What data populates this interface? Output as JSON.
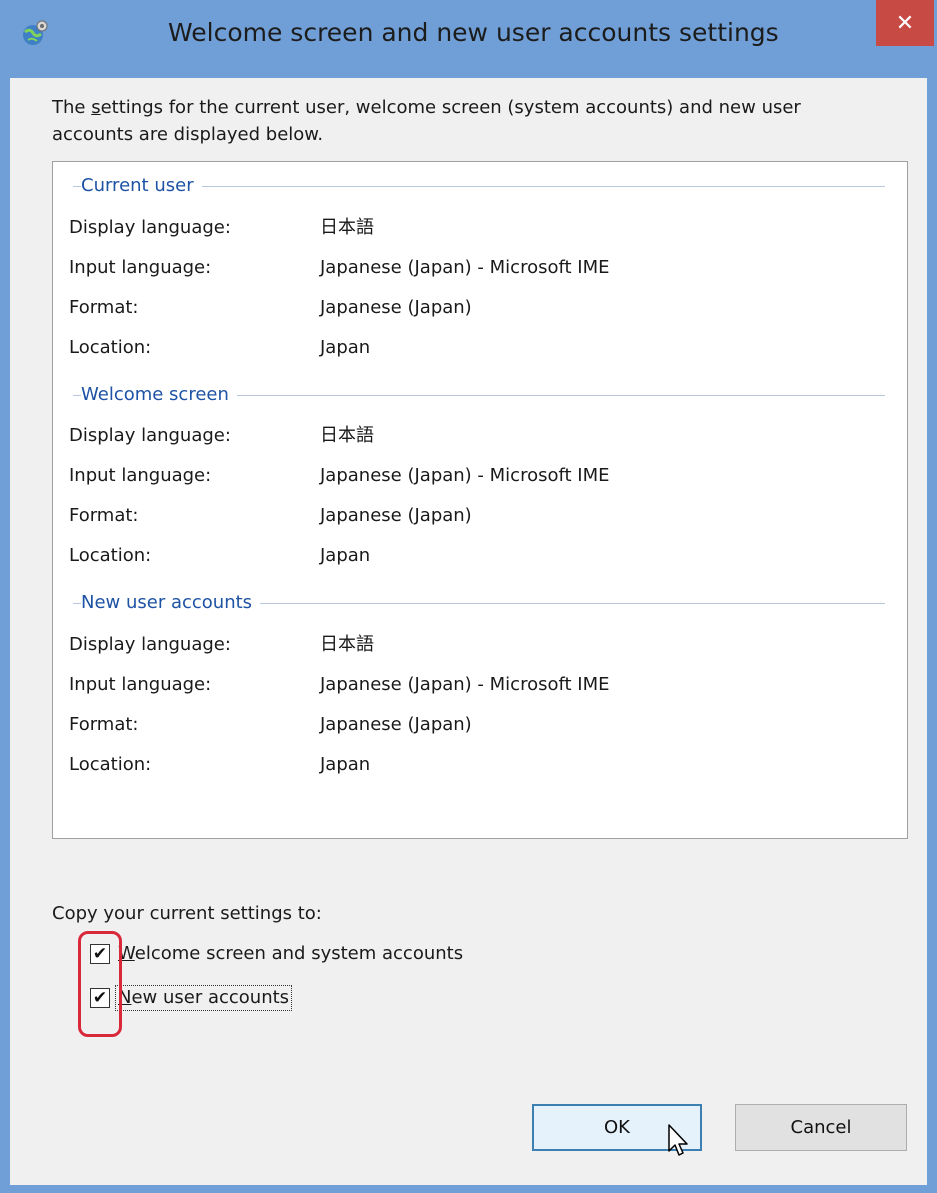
{
  "window": {
    "title": "Welcome screen and new user accounts settings",
    "close_label": "✕"
  },
  "intro": {
    "before_accel": "The ",
    "accel": "s",
    "after_accel": "ettings for the current user, welcome screen (system accounts) and new user accounts are displayed below."
  },
  "sections": [
    {
      "title": "Current user",
      "rows": [
        {
          "label": "Display language:",
          "value": "日本語"
        },
        {
          "label": "Input language:",
          "value": "Japanese (Japan) - Microsoft IME"
        },
        {
          "label": "Format:",
          "value": "Japanese (Japan)"
        },
        {
          "label": "Location:",
          "value": "Japan"
        }
      ]
    },
    {
      "title": "Welcome screen",
      "rows": [
        {
          "label": "Display language:",
          "value": "日本語"
        },
        {
          "label": "Input language:",
          "value": "Japanese (Japan) - Microsoft IME"
        },
        {
          "label": "Format:",
          "value": "Japanese (Japan)"
        },
        {
          "label": "Location:",
          "value": "Japan"
        }
      ]
    },
    {
      "title": "New user accounts",
      "rows": [
        {
          "label": "Display language:",
          "value": "日本語"
        },
        {
          "label": "Input language:",
          "value": "Japanese (Japan) - Microsoft IME"
        },
        {
          "label": "Format:",
          "value": "Japanese (Japan)"
        },
        {
          "label": "Location:",
          "value": "Japan"
        }
      ]
    }
  ],
  "copy": {
    "title": "Copy your current settings to:",
    "welcome": {
      "checked": true,
      "mark": "✔",
      "accel": "W",
      "rest": "elcome screen and system accounts"
    },
    "new_users": {
      "checked": true,
      "mark": "✔",
      "accel": "N",
      "rest": "ew user accounts"
    }
  },
  "buttons": {
    "ok": "OK",
    "cancel": "Cancel"
  },
  "colors": {
    "frame": "#6f9fd6",
    "close": "#c74a45",
    "group_title": "#1d52a5",
    "highlight": "#d9283a"
  }
}
